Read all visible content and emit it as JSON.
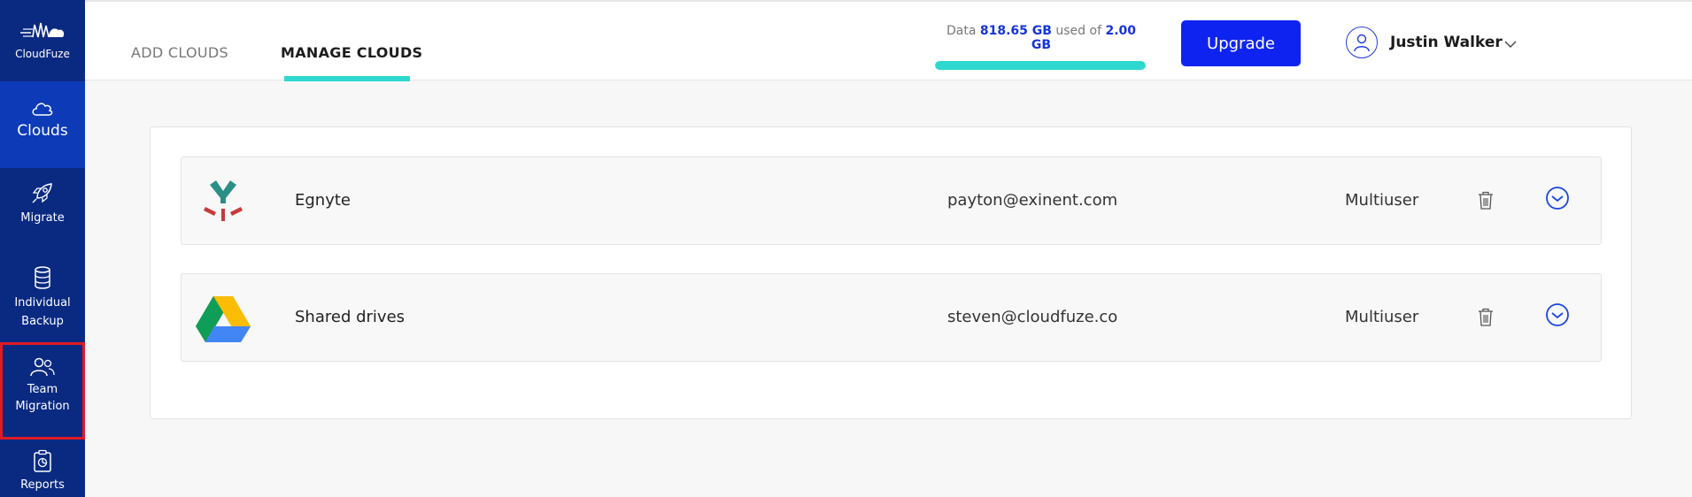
{
  "sidebar": {
    "logo_text": "CloudFuze",
    "items": [
      {
        "label": "Clouds",
        "icon": "cloud-icon"
      },
      {
        "label": "Migrate",
        "icon": "rocket-icon"
      },
      {
        "label": "Individual Backup",
        "icon": "database-icon"
      },
      {
        "label": "Team Migration",
        "icon": "users-icon"
      },
      {
        "label": "Reports",
        "icon": "clipboard-report-icon"
      }
    ]
  },
  "header": {
    "tabs": [
      {
        "label": "ADD CLOUDS"
      },
      {
        "label": "MANAGE CLOUDS"
      }
    ],
    "storage": {
      "prefix": "Data",
      "used": "818.65 GB",
      "middle": "used of",
      "total": "2.00 GB",
      "fill_fraction": 1.0
    },
    "upgrade_label": "Upgrade",
    "user_name": "Justin Walker"
  },
  "clouds": [
    {
      "name": "Egnyte",
      "email": "payton@exinent.com",
      "type": "Multiuser",
      "icon": "egnyte-logo"
    },
    {
      "name": "Shared drives",
      "email": "steven@cloudfuze.co",
      "type": "Multiuser",
      "icon": "google-drive-logo"
    }
  ],
  "colors": {
    "sidebar": "#0a2a82",
    "sidebar_active": "#0d3bb8",
    "accent": "#2ed8cf",
    "primary": "#0f23f0",
    "highlight": "#e01b24"
  }
}
